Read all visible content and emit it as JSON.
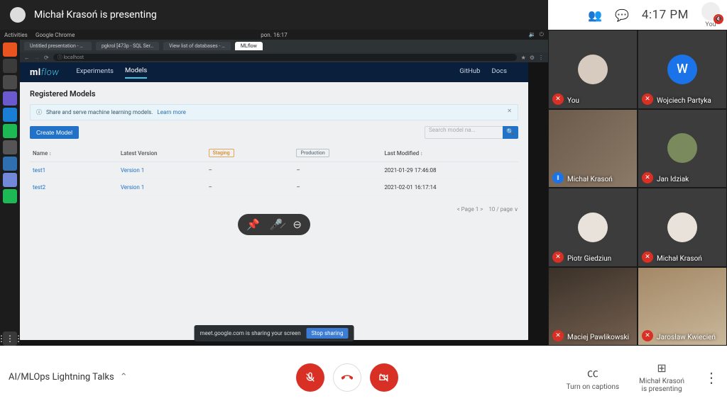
{
  "header": {
    "presenting_label": "Michał Krasoń is presenting",
    "clock": "4:17 PM",
    "you_label": "You"
  },
  "shared_screen": {
    "activities_label": "Activities",
    "topbar_app": "Google Chrome",
    "topbar_time": "pon. 16:17",
    "tabs": [
      "Untitled presentation - G…",
      "pgkrol [473p - SQL Ser…",
      "View list of databases - …",
      "MLflow"
    ],
    "mlflow": {
      "logo_main": "ml",
      "logo_accent": "flow",
      "nav": {
        "experiments": "Experiments",
        "models": "Models",
        "github": "GitHub",
        "docs": "Docs"
      },
      "page_title": "Registered Models",
      "banner_text": "Share and serve machine learning models.",
      "banner_link": "Learn more",
      "create_button": "Create Model",
      "search_placeholder": "Search model na...",
      "columns": {
        "name": "Name",
        "latest": "Latest Version",
        "staging": "Staging",
        "production": "Production",
        "modified": "Last Modified"
      },
      "rows": [
        {
          "name": "test1",
          "version": "Version 1",
          "staging": "–",
          "production": "–",
          "modified": "2021-01-29 17:46:08"
        },
        {
          "name": "test2",
          "version": "Version 1",
          "staging": "–",
          "production": "–",
          "modified": "2021-02-01 16:17:14"
        }
      ],
      "pager_page": "Page 1",
      "pager_size": "10 / page"
    },
    "toast_text": "meet.google.com is sharing your screen",
    "toast_stop": "Stop sharing"
  },
  "participants": [
    {
      "name": "You",
      "muted": true,
      "avatar_bg": "#d7cbbf",
      "kind": "dark"
    },
    {
      "name": "Wojciech Partyka",
      "muted": true,
      "avatar_bg": "#1a73e8",
      "initial": "W",
      "kind": "dark"
    },
    {
      "name": "Michał Krasoń",
      "muted": false,
      "speaking": true,
      "kind": "video",
      "video_bg": "linear-gradient(135deg,#6b5a4a,#8c7a68)"
    },
    {
      "name": "Jan Idziak",
      "muted": true,
      "avatar_bg": "#7a8a5c",
      "kind": "dark"
    },
    {
      "name": "Piotr Giedziun",
      "muted": true,
      "avatar_bg": "#e8e2da",
      "kind": "dark"
    },
    {
      "name": "Michał Krasoń",
      "muted": true,
      "avatar_bg": "#e8e2da",
      "kind": "dark"
    },
    {
      "name": "Maciej Pawlikowski",
      "muted": true,
      "kind": "video",
      "video_bg": "linear-gradient(160deg,#3a3128,#756050)"
    },
    {
      "name": "Jarosław Kwiecień",
      "muted": true,
      "kind": "video",
      "video_bg": "linear-gradient(160deg,#a38866,#c9b79a)"
    }
  ],
  "footer": {
    "meeting_name": "AI/MLOps Lightning Talks",
    "captions": "Turn on captions",
    "presenting_name": "Michał Krasoń",
    "presenting_sub": "is presenting"
  }
}
